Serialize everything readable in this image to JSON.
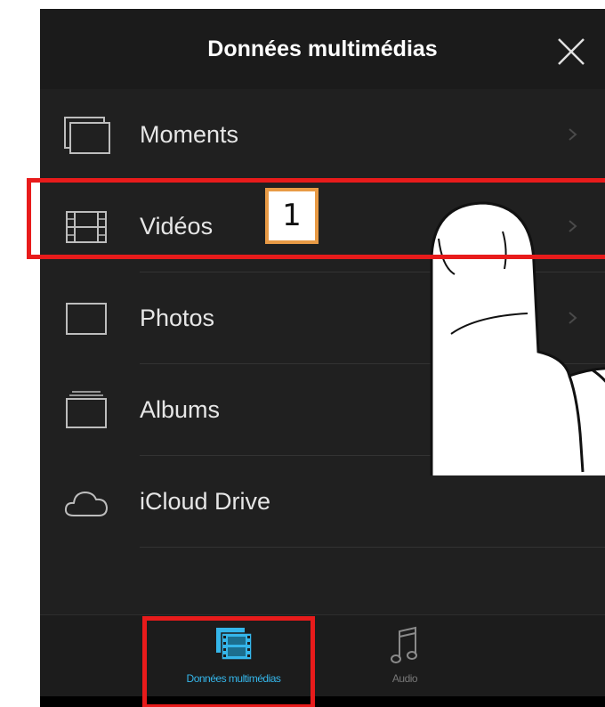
{
  "navbar": {
    "title": "Données multimédias"
  },
  "list": {
    "items": [
      {
        "label": "Moments",
        "icon": "moments-icon",
        "has_chevron": true
      },
      {
        "label": "Vidéos",
        "icon": "film-icon",
        "has_chevron": true
      },
      {
        "label": "Photos",
        "icon": "photo-frame-icon",
        "has_chevron": true
      },
      {
        "label": "Albums",
        "icon": "albums-icon",
        "has_chevron": false
      },
      {
        "label": "iCloud Drive",
        "icon": "cloud-icon",
        "has_chevron": true
      }
    ]
  },
  "tabbar": {
    "tabs": [
      {
        "label": "Données multimédias",
        "icon": "media-film-icon",
        "active": true
      },
      {
        "label": "Audio",
        "icon": "music-note-icon",
        "active": false
      }
    ]
  },
  "annotation": {
    "step_number": "1"
  },
  "colors": {
    "background": "#202020",
    "text": "#e6e6e6",
    "accent": "#35b6ea",
    "highlight": "#e81b1b",
    "badge_border": "#e89a45"
  }
}
